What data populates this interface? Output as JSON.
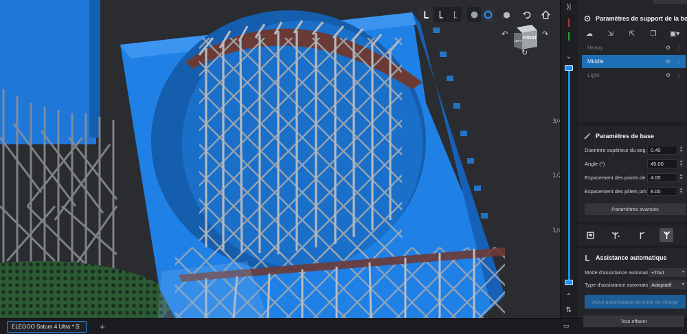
{
  "viewport": {
    "ruler_labels": [
      "3/4",
      "1/2",
      "1/4"
    ],
    "toolbar_icons": [
      "support-tool-1-icon",
      "support-tool-2-icon",
      "support-tool-3-icon",
      "solid-view-icon",
      "xray-view-icon",
      "cube-view-icon",
      "undo-view-icon",
      "home-view-icon"
    ],
    "view_cube": {
      "front": "FRONT",
      "left": "LEFT"
    },
    "colors": {
      "model": "#1a78d6",
      "supports": "#a9aeb4",
      "background": "#2b2c30",
      "accent": "#1d6fb8"
    }
  },
  "support_panel": {
    "title": "Paramètres de support de la boutique",
    "tool_icons": [
      "cloud-upload-icon",
      "import-icon",
      "export-icon",
      "duplicate-icon",
      "save-icon"
    ],
    "presets": [
      {
        "label": "Heavy",
        "selected": false
      },
      {
        "label": "Middle",
        "selected": true
      },
      {
        "label": "Light",
        "selected": false
      }
    ]
  },
  "base_params": {
    "title": "Paramètres de base",
    "rows": [
      {
        "label": "Diamètre supérieur du seg...",
        "value": "0.40"
      },
      {
        "label": "Angle (°)",
        "value": "45.00"
      },
      {
        "label": "Espacement des points de ...",
        "value": "4.00"
      },
      {
        "label": "Espacement des piliers prin...",
        "value": "8.00"
      }
    ],
    "advanced_button": "Paramètres avancés"
  },
  "auto_support": {
    "title": "Assistance automatique",
    "mode_label": "Mode d'assistance automatique",
    "mode_value": "+Tout",
    "type_label": "Type d'assistance automatique",
    "type_value": "Adaptatif",
    "generate_button": "Ajout automatique de prise en charge",
    "clear_button": "Tout effacer"
  },
  "tabs": {
    "file_tab": "ELEGOO Saturn 4 Ultra * S",
    "add_tab": "+"
  }
}
